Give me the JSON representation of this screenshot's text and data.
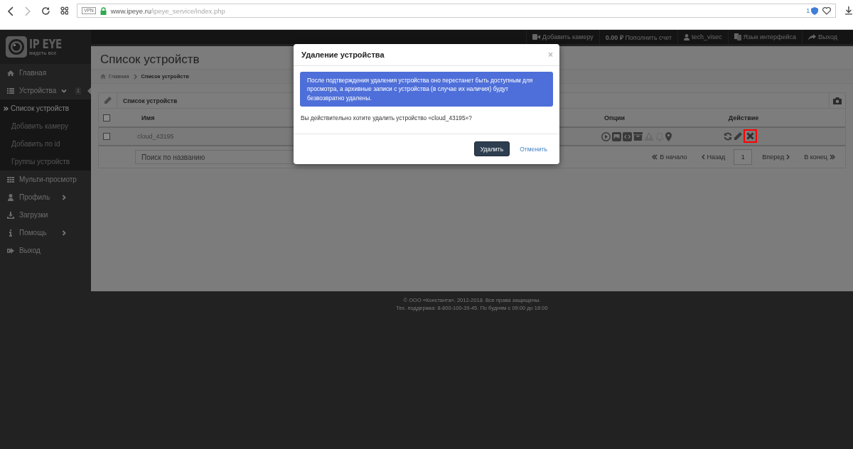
{
  "browser": {
    "vpn_label": "VPN",
    "url_host": "www.ipeye.ru",
    "url_path": "/ipeye_service/index.php",
    "badge": "1"
  },
  "logo": {
    "brand": "IP EYE",
    "tagline": "видеть все"
  },
  "top_nav": [
    {
      "kind": "camera",
      "label": "Добавить камеру"
    },
    {
      "kind": "balance",
      "label": "**0.00 ₽** Пополнить счет"
    },
    {
      "kind": "user",
      "label": "tech_visec"
    },
    {
      "kind": "language",
      "label": "Язык интерфейса"
    },
    {
      "kind": "logout",
      "label": "Выход"
    }
  ],
  "sidebar": {
    "items": [
      {
        "kind": "home",
        "label": "Главная"
      },
      {
        "kind": "list",
        "label": "Устройства",
        "expanded": true,
        "badge": "1",
        "children": [
          {
            "label": "Список устройств",
            "selected": true
          },
          {
            "label": "Добавить камеру",
            "selected": false
          },
          {
            "label": "Добавить по id",
            "selected": false
          },
          {
            "label": "Группы устройств",
            "selected": false
          }
        ]
      },
      {
        "kind": "grid",
        "label": "Мульти-просмотр"
      },
      {
        "kind": "user",
        "label": "Профиль",
        "expanded": false
      },
      {
        "kind": "download",
        "label": "Загрузки"
      },
      {
        "kind": "info",
        "label": "Помощь",
        "expanded": false
      },
      {
        "kind": "logout",
        "label": "Выход"
      }
    ]
  },
  "page": {
    "title": "Список устройств",
    "breadcrumbs": [
      "Главная",
      "Список устройств"
    ]
  },
  "table": {
    "panel_title": "Список устройств",
    "columns": [
      "Имя",
      "Опции",
      "Действие"
    ],
    "rows": [
      {
        "checked": false,
        "name": "cloud_43195",
        "actions": [
          {
            "kind": "refresh",
            "highlighted": false
          },
          {
            "kind": "edit",
            "highlighted": false
          },
          {
            "kind": "delete",
            "highlighted": true
          }
        ]
      }
    ],
    "header_checked": false,
    "search": {
      "placeholder": "Поиск по названию"
    },
    "pagination": {
      "first": "В начало",
      "prev": "Назад",
      "page": "1",
      "next": "Вперед",
      "last": "В конец"
    }
  },
  "modal": {
    "title": "Удаление устройства",
    "close": "×",
    "alert": "После подтверждения удаления устройства оно перестанет быть доступным для просмотра, а архивные записи с устройства (в случае их наличия) будут безвозвратно удалены.",
    "question": "Вы действительно хотите удалить устройство «cloud_43195»?",
    "confirm": "Удалить",
    "cancel": "Отменить"
  },
  "footer": [
    "© ООО «Константа», 2012-2018. Все права защищены.",
    "Тех. поддержка: 8-800-100-39-45. По будням с 09:00 до 18:00"
  ]
}
